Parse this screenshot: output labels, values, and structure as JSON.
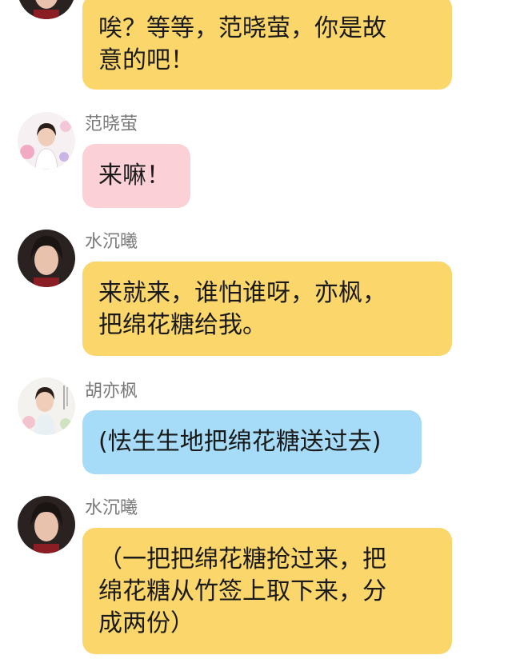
{
  "messages": [
    {
      "sender": "",
      "avatar": "dark-haired-woman-avatar-icon",
      "text": "唉？等等，范晓萤，你是故\n意的吧！",
      "bubble_color": "#fbd66b"
    },
    {
      "sender": "范晓萤",
      "avatar": "girl-floral-avatar-icon",
      "text": "来嘛！",
      "bubble_color": "#fbd0d6"
    },
    {
      "sender": "水沉曦",
      "avatar": "dark-haired-woman-avatar-icon",
      "text": "来就来，谁怕谁呀，亦枫，\n把绵花糖给我。",
      "bubble_color": "#fbd66b"
    },
    {
      "sender": "胡亦枫",
      "avatar": "young-man-floral-avatar-icon",
      "text": "(怯生生地把绵花糖送过去)",
      "bubble_color": "#a6dcf7"
    },
    {
      "sender": "水沉曦",
      "avatar": "dark-haired-woman-avatar-icon",
      "text": "（一把把绵花糖抢过来，把\n绵花糖从竹签上取下来，分\n成两份）",
      "bubble_color": "#fbd66b"
    }
  ]
}
